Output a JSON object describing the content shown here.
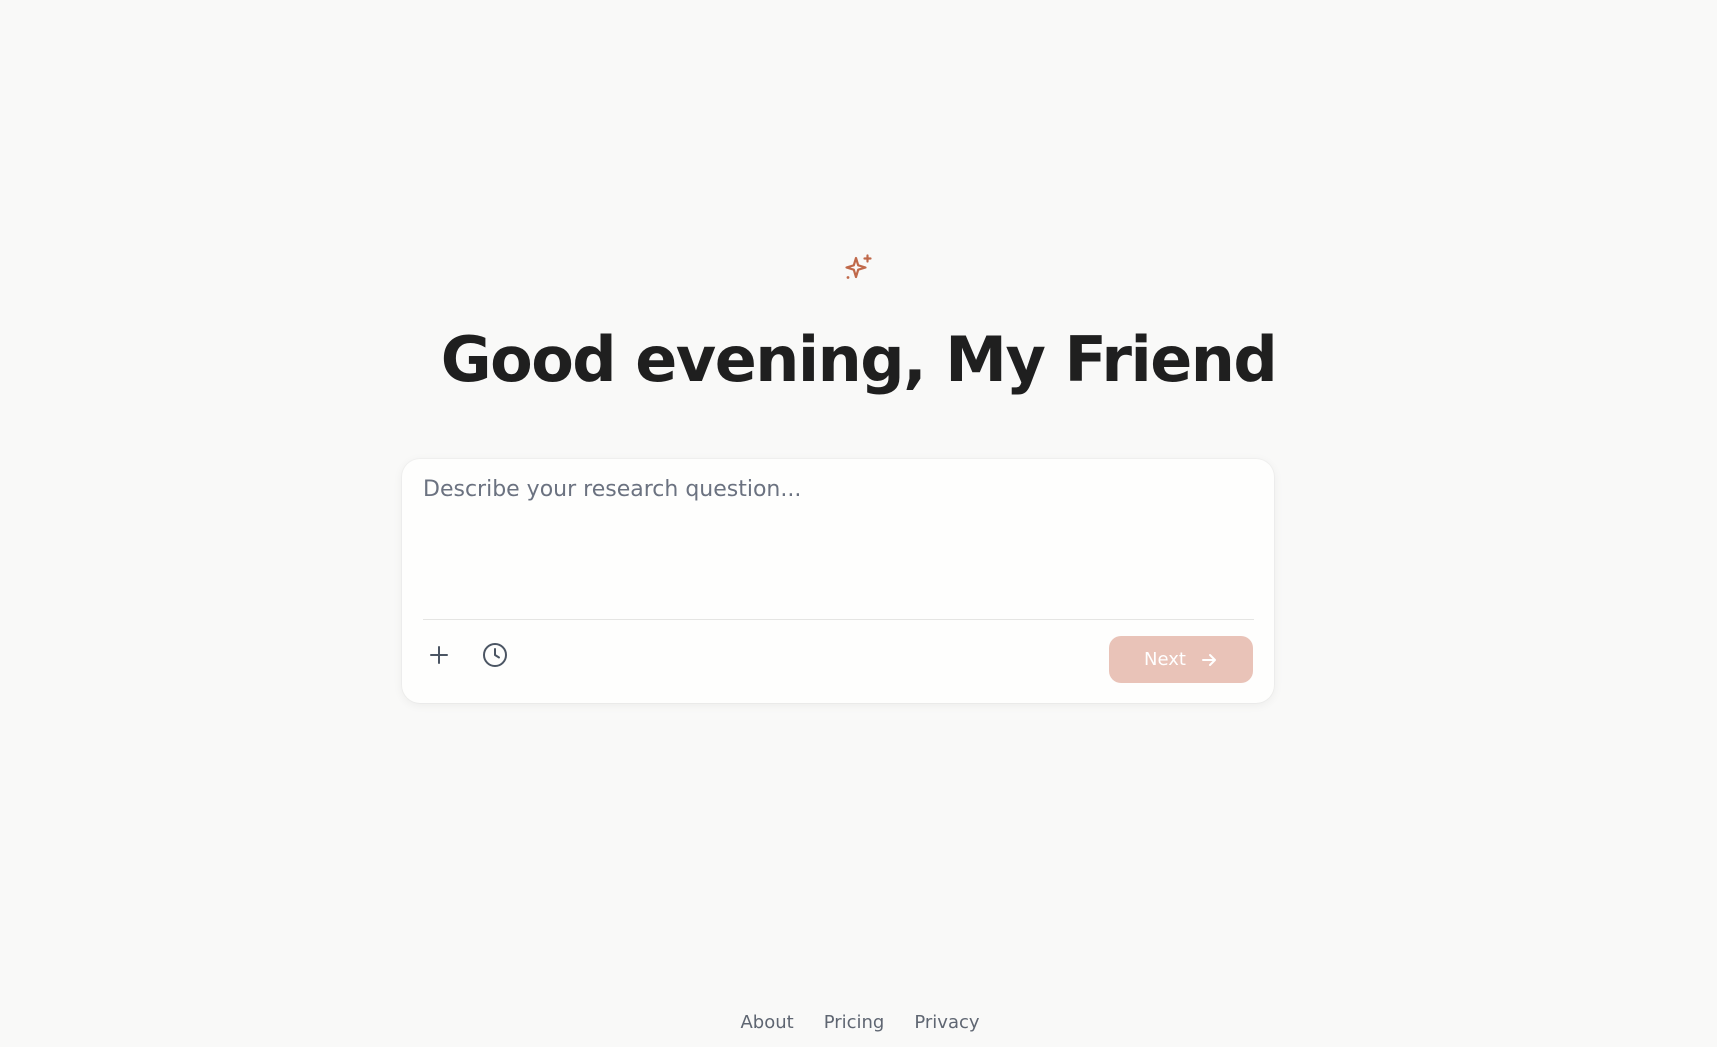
{
  "hero": {
    "icon": "sparkle-icon",
    "accent_color": "#c0694a",
    "greeting": "Good evening, My Friend"
  },
  "composer": {
    "placeholder": "Describe your research question...",
    "value": "",
    "add_icon": "plus-icon",
    "history_icon": "clock-icon",
    "next_label": "Next",
    "next_icon": "arrow-right-icon",
    "next_color": "#e9c3b8"
  },
  "footer": {
    "links": [
      {
        "label": "About"
      },
      {
        "label": "Pricing"
      },
      {
        "label": "Privacy"
      }
    ]
  }
}
